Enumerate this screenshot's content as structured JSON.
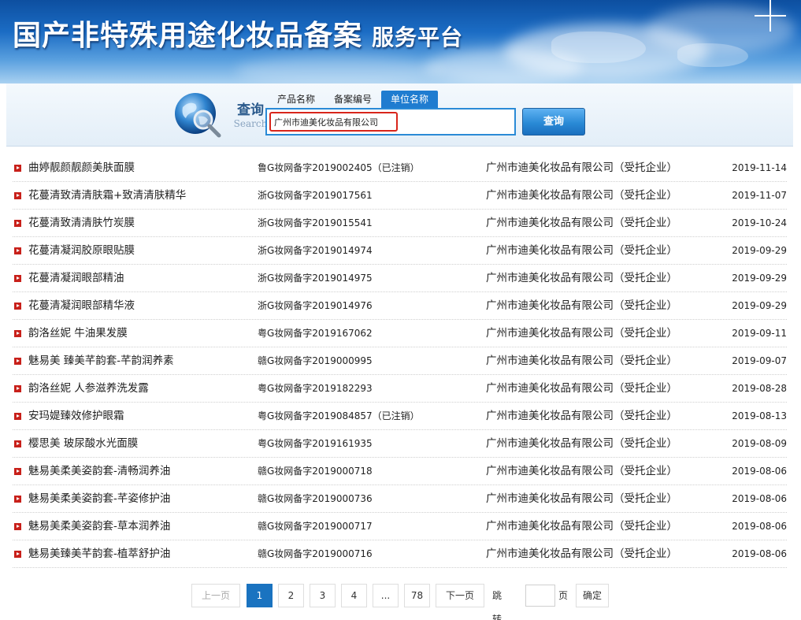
{
  "banner": {
    "title": "国产非特殊用途化妆品备案",
    "subtitle": "服务平台"
  },
  "search": {
    "label_cn": "查询",
    "label_en": "Search",
    "tabs": [
      {
        "label": "产品名称",
        "active": false
      },
      {
        "label": "备案编号",
        "active": false
      },
      {
        "label": "单位名称",
        "active": true
      }
    ],
    "input_value": "广州市迪美化妆品有限公司",
    "button_label": "查询"
  },
  "rows": [
    {
      "name": "曲婷靓颜靓颜美肤面膜",
      "code": "鲁G妆网备字2019002405（已注销）",
      "company": "广州市迪美化妆品有限公司（受托企业）",
      "date": "2019-11-14"
    },
    {
      "name": "花蔓清致清清肤霜+致清清肤精华",
      "code": "浙G妆网备字2019017561",
      "company": "广州市迪美化妆品有限公司（受托企业）",
      "date": "2019-11-07"
    },
    {
      "name": "花蔓清致清清肤竹炭膜",
      "code": "浙G妆网备字2019015541",
      "company": "广州市迪美化妆品有限公司（受托企业）",
      "date": "2019-10-24"
    },
    {
      "name": "花蔓清凝润胶原眼贴膜",
      "code": "浙G妆网备字2019014974",
      "company": "广州市迪美化妆品有限公司（受托企业）",
      "date": "2019-09-29"
    },
    {
      "name": "花蔓清凝润眼部精油",
      "code": "浙G妆网备字2019014975",
      "company": "广州市迪美化妆品有限公司（受托企业）",
      "date": "2019-09-29"
    },
    {
      "name": "花蔓清凝润眼部精华液",
      "code": "浙G妆网备字2019014976",
      "company": "广州市迪美化妆品有限公司（受托企业）",
      "date": "2019-09-29"
    },
    {
      "name": "韵洛丝妮 牛油果发膜",
      "code": "粤G妆网备字2019167062",
      "company": "广州市迪美化妆品有限公司（受托企业）",
      "date": "2019-09-11"
    },
    {
      "name": "魅易美 臻美芊韵套-芊韵润养素",
      "code": "赣G妆网备字2019000995",
      "company": "广州市迪美化妆品有限公司（受托企业）",
      "date": "2019-09-07"
    },
    {
      "name": "韵洛丝妮 人参滋养洗发露",
      "code": "粤G妆网备字2019182293",
      "company": "广州市迪美化妆品有限公司（受托企业）",
      "date": "2019-08-28"
    },
    {
      "name": "安玛媞臻效修护眼霜",
      "code": "粤G妆网备字2019084857（已注销）",
      "company": "广州市迪美化妆品有限公司（受托企业）",
      "date": "2019-08-13"
    },
    {
      "name": "樱思美 玻尿酸水光面膜",
      "code": "粤G妆网备字2019161935",
      "company": "广州市迪美化妆品有限公司（受托企业）",
      "date": "2019-08-09"
    },
    {
      "name": "魅易美柔美姿韵套-清畅润养油",
      "code": "赣G妆网备字2019000718",
      "company": "广州市迪美化妆品有限公司（受托企业）",
      "date": "2019-08-06"
    },
    {
      "name": "魅易美柔美姿韵套-芊姿修护油",
      "code": "赣G妆网备字2019000736",
      "company": "广州市迪美化妆品有限公司（受托企业）",
      "date": "2019-08-06"
    },
    {
      "name": "魅易美柔美姿韵套-草本润养油",
      "code": "赣G妆网备字2019000717",
      "company": "广州市迪美化妆品有限公司（受托企业）",
      "date": "2019-08-06"
    },
    {
      "name": "魅易美臻美芊韵套-植萃舒护油",
      "code": "赣G妆网备字2019000716",
      "company": "广州市迪美化妆品有限公司（受托企业）",
      "date": "2019-08-06"
    }
  ],
  "pagination": {
    "prev_label": "上一页",
    "pages": [
      "1",
      "2",
      "3",
      "4"
    ],
    "current_page": "1",
    "ellipsis": "...",
    "last_page": "78",
    "next_label": "下一页",
    "jump_label": "跳转到",
    "page_unit": "页",
    "confirm_label": "确定"
  },
  "colors": {
    "accent": "#1a73c0",
    "bullet": "#c8201a",
    "highlight_border": "#d8251b"
  }
}
